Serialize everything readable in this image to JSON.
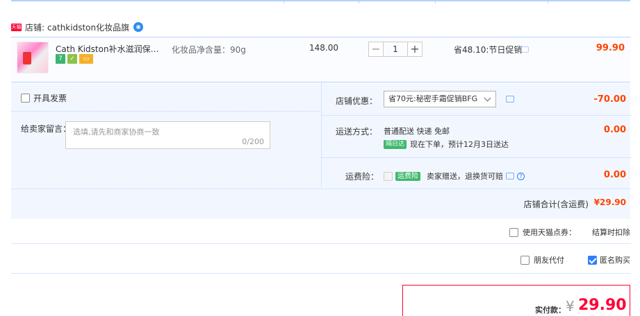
{
  "shop": {
    "badge": "天猫",
    "label": "店铺:",
    "name": "cathkidston化妆品旗"
  },
  "item": {
    "title": "Cath Kidston补水滋润保湿护…",
    "spec": "化妆品净含量：90g",
    "unit_price": "148.00",
    "quantity": "1",
    "qty_minus": "−",
    "qty_plus": "+",
    "promo": "省48.10:节日促销",
    "subtotal": "99.90",
    "icons": [
      "7",
      "✓"
    ]
  },
  "options": {
    "invoice_label": "开具发票",
    "message_label": "给卖家留言：",
    "message_placeholder": "选填,请先和商家协商一致",
    "message_count": "0/200",
    "coupon_label": "店铺优惠：",
    "coupon_value": "省70元:秘密手霜促销BFG",
    "coupon_amount": "-70.00",
    "shipping_label": "运送方式：",
    "shipping_method": "普通配送 快递 免邮",
    "shipping_badge": "隔日达",
    "shipping_note": "现在下单，预计12月3日送达",
    "shipping_amount": "0.00",
    "insurance_label": "运费险：",
    "insurance_badge": "运费险",
    "insurance_note": "卖家赠送，退换货可赔",
    "insurance_amount": "0.00",
    "shop_total_label": "店铺合计(含运费)",
    "shop_total_amount": "¥29.90"
  },
  "extras": {
    "tmall_points_label": "使用天猫点券：",
    "tmall_points_note": "结算时扣除",
    "friend_pay_label": "朋友代付",
    "anonymous_label": "匿名购买",
    "anonymous_checked": true
  },
  "payment": {
    "label": "实付款：",
    "currency": "¥",
    "amount": "29.90"
  },
  "colors": {
    "accent_red": "#ff0036",
    "price_orange": "#f40",
    "border_blue": "#b2d1ff",
    "panel_bg": "#f2f7ff",
    "check_blue": "#2d7ff9"
  }
}
